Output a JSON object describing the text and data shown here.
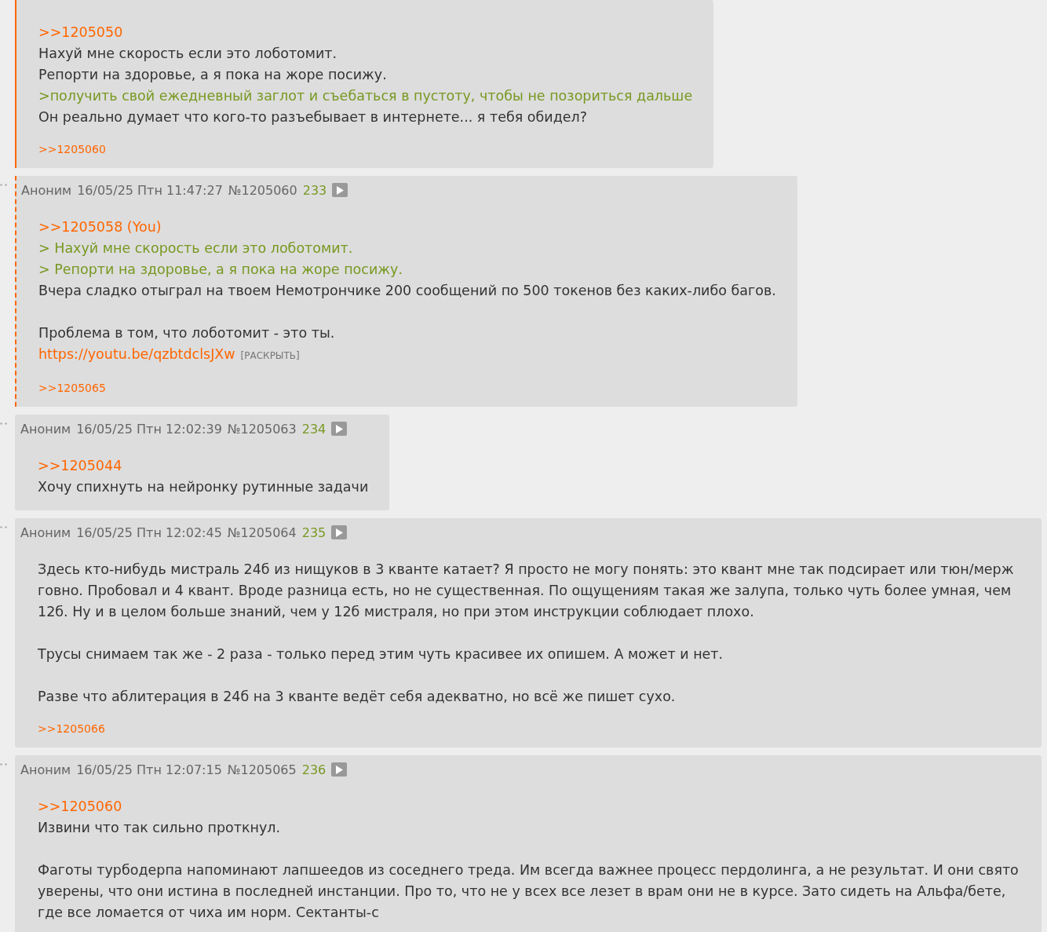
{
  "posts": [
    {
      "kind": "own",
      "body": [
        {
          "kind": "reply",
          "text": ">>1205050"
        },
        {
          "kind": "text",
          "text": "Нахуй мне скорость если это лоботомит."
        },
        {
          "kind": "text",
          "text": "Репорти на здоровье, а я пока на жоре посижу."
        },
        {
          "kind": "quote",
          "text": ">получить свой ежедневный заглот и съебаться в пустоту, чтобы не позориться дальше"
        },
        {
          "kind": "text",
          "text": "Он реально думает что кого-то разъебывает в интернете... я тебя обидел?"
        }
      ],
      "replies": [
        ">>1205060"
      ]
    },
    {
      "kind": "reply",
      "header": {
        "name": "Аноним",
        "date": "16/05/25 Птн 11:47:27",
        "number": "№1205060",
        "index": "233"
      },
      "body": [
        {
          "kind": "reply",
          "text": ">>1205058 (You)"
        },
        {
          "kind": "quote",
          "text": "> Нахуй мне скорость если это лоботомит."
        },
        {
          "kind": "quote",
          "text": "> Репорти на здоровье, а я пока на жоре посижу."
        },
        {
          "kind": "text",
          "text": "Вчера сладко отыграл на твоем Немотрончике 200 сообщений по 500 токенов без каких-либо багов."
        },
        {
          "kind": "blank"
        },
        {
          "kind": "text",
          "text": "Проблема в том, что лоботомит - это ты."
        },
        {
          "kind": "link",
          "text": "https://youtu.be/qzbtdclsJXw",
          "expand": "[РАСКРЫТЬ]"
        }
      ],
      "replies": [
        ">>1205065"
      ]
    },
    {
      "kind": "plain",
      "header": {
        "name": "Аноним",
        "date": "16/05/25 Птн 12:02:39",
        "number": "№1205063",
        "index": "234"
      },
      "body": [
        {
          "kind": "reply",
          "text": ">>1205044"
        },
        {
          "kind": "text",
          "text": "Хочу спихнуть на нейронку рутинные задачи"
        }
      ]
    },
    {
      "kind": "plain",
      "header": {
        "name": "Аноним",
        "date": "16/05/25 Птн 12:02:45",
        "number": "№1205064",
        "index": "235"
      },
      "body": [
        {
          "kind": "text",
          "text": "Здесь кто-нибудь мистраль 24б из нищуков в 3 кванте катает? Я просто не могу понять: это квант мне так подсирает или тюн/мерж говно. Пробовал и 4 квант. Вроде разница есть, но не существенная. По ощущениям такая же залупа, только чуть более умная, чем 12б. Ну и в целом больше знаний, чем у 12б мистраля, но при этом инструкции соблюдает плохо."
        },
        {
          "kind": "blank"
        },
        {
          "kind": "text",
          "text": "Трусы снимаем так же - 2 раза - только перед этим чуть красивее их опишем. А может и нет."
        },
        {
          "kind": "blank"
        },
        {
          "kind": "text",
          "text": "Разве что аблитерация в 24б на 3 кванте ведёт себя адекватно, но всё же пишет сухо."
        }
      ],
      "replies": [
        ">>1205066"
      ]
    },
    {
      "kind": "plain",
      "header": {
        "name": "Аноним",
        "date": "16/05/25 Птн 12:07:15",
        "number": "№1205065",
        "index": "236"
      },
      "body": [
        {
          "kind": "reply",
          "text": ">>1205060"
        },
        {
          "kind": "text",
          "text": "Извини что так сильно проткнул."
        },
        {
          "kind": "blank"
        },
        {
          "kind": "text",
          "text": "Фаготы турбодерпа напоминают лапшеедов из соседнего треда. Им всегда важнее процесс пердолинга, а не результат. И они свято уверены, что они истина в последней инстанции. Про то, что не у всех все лезет в врам они не в курсе. Зато сидеть на Альфа/бете, где все ломается от чиха им норм. Сектанты-с"
        }
      ]
    }
  ]
}
